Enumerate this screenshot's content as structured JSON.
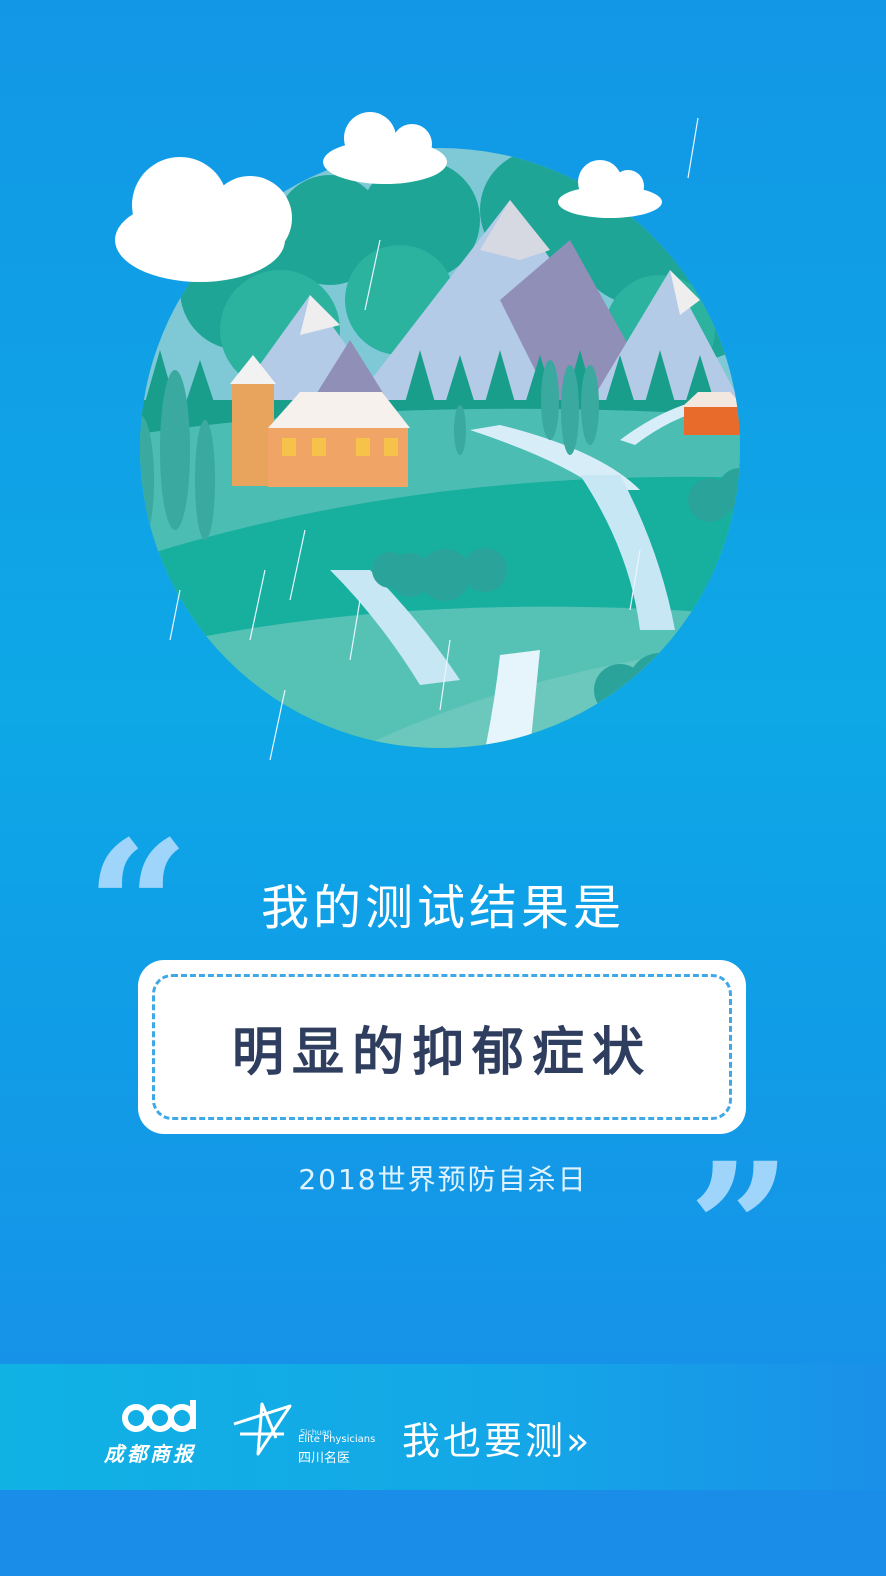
{
  "headline": "我的测试结果是",
  "result": "明显的抑郁症状",
  "event": "2018世界预防自杀日",
  "footer": {
    "partner1": {
      "name": "成都商报",
      "icon": "cdsb-logo"
    },
    "partner2": {
      "en_small": "Sichuan",
      "en": "Elite Physicians",
      "cn": "四川名医",
      "icon": "elite-physicians-logo"
    },
    "cta": "我也要测»"
  },
  "quotes": {
    "open": "“",
    "close": "”"
  },
  "colors": {
    "background": "#0ea8e6",
    "card": "#ffffff",
    "result_text": "#2f3e5f",
    "dash": "#3fa9e8",
    "quote": "#9fd5fb"
  }
}
